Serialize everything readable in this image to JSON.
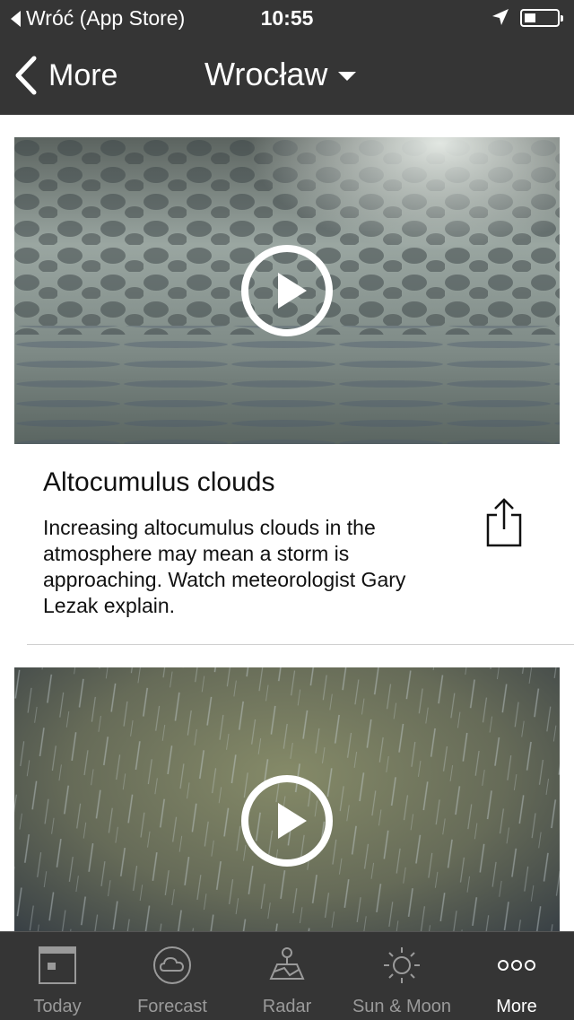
{
  "status_bar": {
    "back_app": "Wróć (App Store)",
    "time": "10:55"
  },
  "nav": {
    "back_label": "More",
    "location": "Wrocław"
  },
  "videos": [
    {
      "title": "Altocumulus clouds",
      "description": "Increasing altocumulus clouds in the atmosphere may mean a storm is approaching. Watch meteorologist Gary Lezak explain."
    },
    {
      "title": "",
      "description": ""
    }
  ],
  "tabs": [
    {
      "label": "Today",
      "icon": "calendar-icon"
    },
    {
      "label": "Forecast",
      "icon": "cloud-icon"
    },
    {
      "label": "Radar",
      "icon": "map-icon"
    },
    {
      "label": "Sun & Moon",
      "icon": "sun-icon"
    },
    {
      "label": "More",
      "icon": "more-dots-icon",
      "active": true
    }
  ],
  "colors": {
    "bar_bg": "#353535",
    "tab_inactive": "#9a9a9a",
    "tab_active": "#ffffff"
  }
}
